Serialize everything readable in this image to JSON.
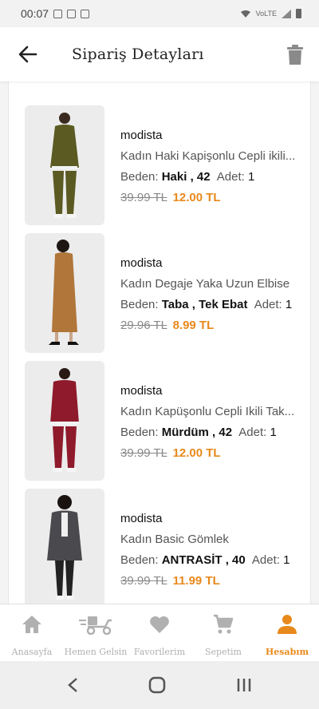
{
  "status_bar": {
    "time": "00:07",
    "network": "VoLTE"
  },
  "header": {
    "title": "Sipariş Detayları",
    "back_icon": "arrow-left-icon",
    "delete_icon": "trash-icon"
  },
  "labels": {
    "size_label": "Beden:",
    "qty_label": "Adet:"
  },
  "items": [
    {
      "brand": "modista",
      "name": "Kadın Haki Kapişonlu Cepli ikili...",
      "size": "Haki , 42",
      "qty": "1",
      "old_price": "39.99 TL",
      "new_price": "12.00 TL",
      "color": "#5a5a22"
    },
    {
      "brand": "modista",
      "name": "Kadın Degaje Yaka Uzun Elbise",
      "size": "Taba , Tek Ebat",
      "qty": "1",
      "old_price": "29.96 TL",
      "new_price": "8.99 TL",
      "color": "#b0763a"
    },
    {
      "brand": "modista",
      "name": "Kadın Kapüşonlu Cepli Ikili Tak...",
      "size": "Mürdüm , 42",
      "qty": "1",
      "old_price": "39.99 TL",
      "new_price": "12.00 TL",
      "color": "#8e1a2c"
    },
    {
      "brand": "modista",
      "name": "Kadın Basic Gömlek",
      "size": "ANTRASİT , 40",
      "qty": "1",
      "old_price": "39.99 TL",
      "new_price": "11.99 TL",
      "color": "#4a4a4e"
    }
  ],
  "bottom_nav": [
    {
      "label": "Anasayfa",
      "icon": "home-icon",
      "active": false
    },
    {
      "label": "Hemen Gelsin",
      "icon": "delivery-scooter-icon",
      "active": false
    },
    {
      "label": "Favorilerim",
      "icon": "heart-icon",
      "active": false
    },
    {
      "label": "Sepetim",
      "icon": "cart-icon",
      "active": false
    },
    {
      "label": "Hesabım",
      "icon": "person-icon",
      "active": true
    }
  ],
  "colors": {
    "accent": "#e8891c",
    "inactive": "#b0b0b0"
  }
}
